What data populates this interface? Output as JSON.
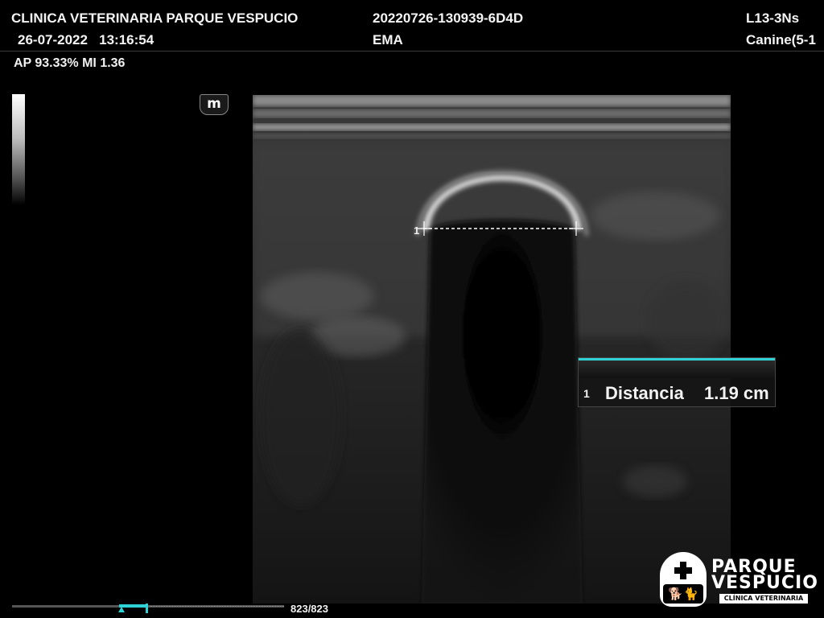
{
  "header": {
    "clinic_name": "CLINICA VETERINARIA PARQUE VESPUCIO",
    "date_time": "26-07-2022   13:16:54",
    "exam_id": "20220726-130939-6D4D",
    "operator": "EMA",
    "probe": "L13-3Ns",
    "preset": "Canine(5-1"
  },
  "acoustic": {
    "text": "AP 93.33%  MI 1.36"
  },
  "orientation_marker": "m",
  "caliper": {
    "index": "1"
  },
  "measurement": {
    "index": "1",
    "label": "Distancia",
    "value": "1.19 cm",
    "accent_color": "#2fd3d6"
  },
  "cine": {
    "frame_counter": "823/823"
  },
  "logo": {
    "line1": "PARQUE",
    "line2": "VESPUCIO",
    "subtitle": "CLÍNICA VETERINARIA",
    "icons": [
      "plus-icon",
      "pets-icon"
    ]
  }
}
